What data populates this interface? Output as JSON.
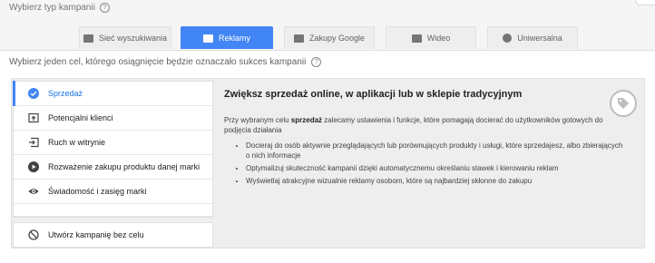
{
  "campaign_type": {
    "question": "Wybierz typ kampanii",
    "tabs": [
      {
        "label": "Sieć wyszukiwania",
        "icon": "search-icon"
      },
      {
        "label": "Reklamy",
        "icon": "display-icon",
        "active": true
      },
      {
        "label": "Zakupy Google",
        "icon": "tag-icon"
      },
      {
        "label": "Wideo",
        "icon": "video-icon"
      },
      {
        "label": "Uniwersalna",
        "icon": "download-icon"
      }
    ]
  },
  "goals": {
    "question": "Wybierz jeden cel, którego osiągnięcie będzie oznaczało sukces kampanii",
    "items": [
      {
        "label": "Sprzedaż",
        "icon": "check-circle-icon",
        "selected": true
      },
      {
        "label": "Potencjalni klienci",
        "icon": "leads-icon"
      },
      {
        "label": "Ruch w witrynie",
        "icon": "site-traffic-icon"
      },
      {
        "label": "Rozważenie zakupu produktu danej marki",
        "icon": "play-circle-icon"
      },
      {
        "label": "Świadomość i zasięg marki",
        "icon": "eye-icon"
      }
    ],
    "no_goal_label": "Utwórz kampanię bez celu",
    "no_goal_icon": "block-icon"
  },
  "detail": {
    "title": "Zwiększ sprzedaż online, w aplikacji lub w sklepie tradycyjnym",
    "intro_prefix": "Przy wybranym celu ",
    "intro_bold": "sprzedaż",
    "intro_suffix": " zalecamy ustawienia i funkcje, które pomagają docierać do użytkowników gotowych do podjęcia działania",
    "bullets": [
      "Docieraj do osób aktywnie przeglądających lub porównujących produkty i usługi, które sprzedajesz, albo zbierających o nich informacje",
      "Optymalizuj skuteczność kampanii dzięki automatycznemu określaniu stawek i kierowaniu reklam",
      "Wyświetlaj atrakcyjne wizualnie reklamy osobom, które są najbardziej skłonne do zakupu"
    ],
    "badge_icon": "tag-icon"
  },
  "colors": {
    "accent": "#4285f4",
    "selected_text": "#1a73e8"
  }
}
